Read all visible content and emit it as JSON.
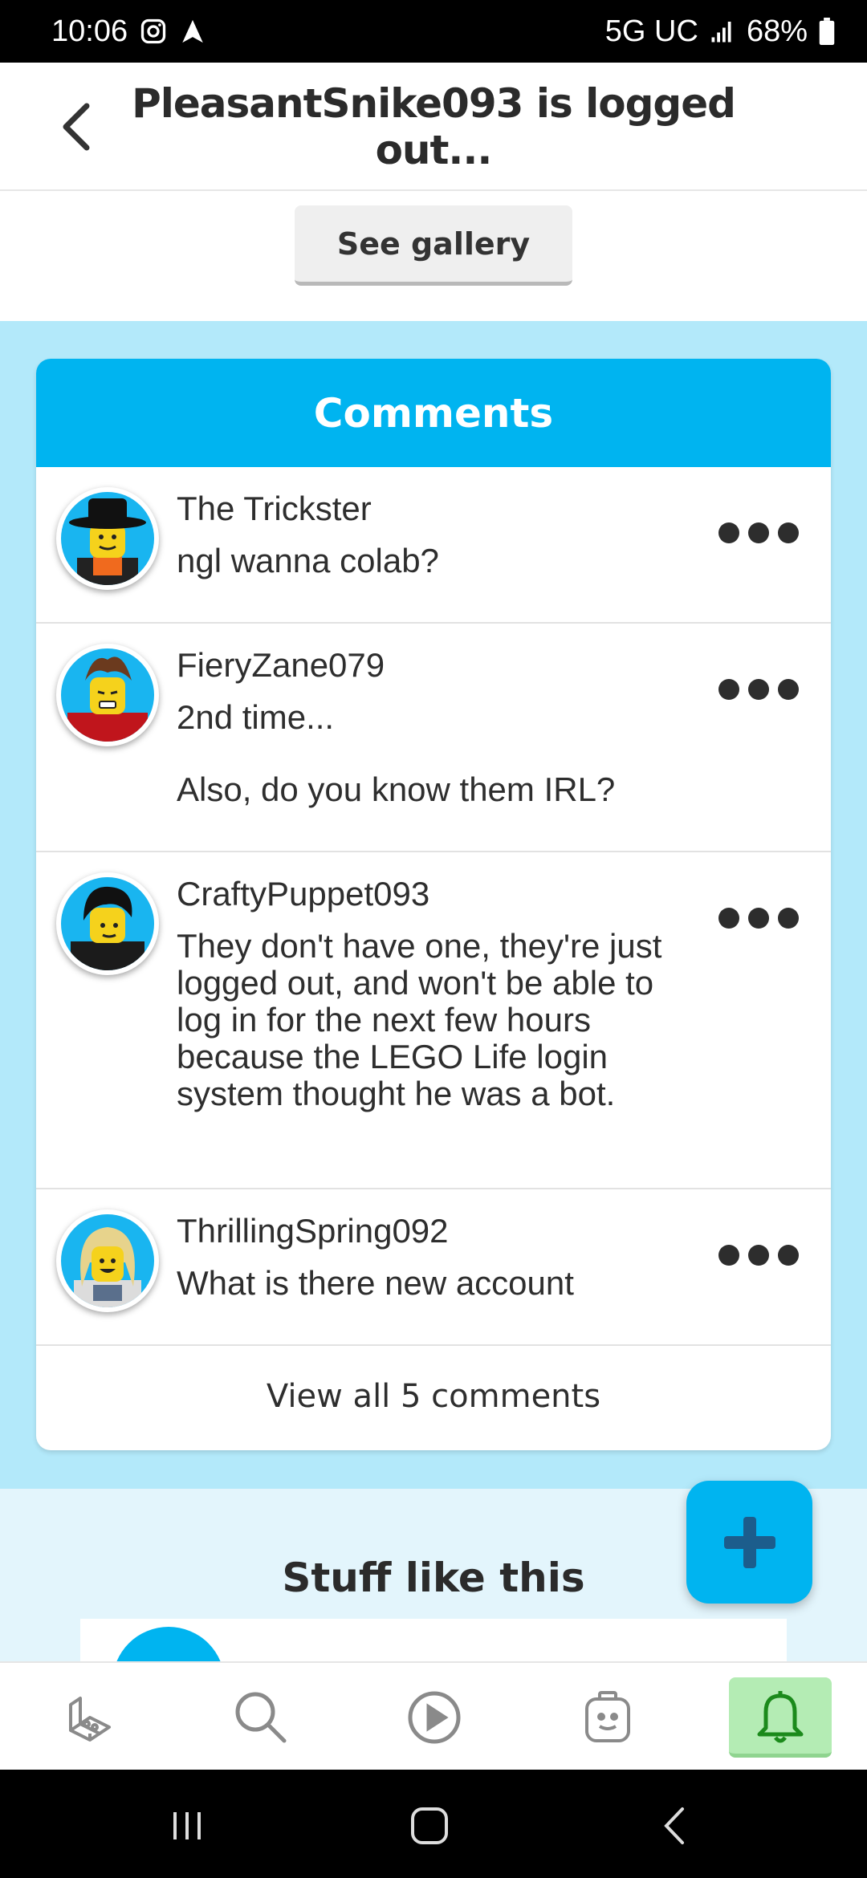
{
  "status_bar": {
    "time": "10:06",
    "network": "5G UC",
    "battery": "68%"
  },
  "header": {
    "title": "PleasantSnike093 is logged out..."
  },
  "gallery": {
    "see_gallery_label": "See gallery"
  },
  "comments": {
    "heading": "Comments",
    "items": [
      {
        "author": "The Trickster",
        "text": "ngl wanna colab?"
      },
      {
        "author": "FieryZane079",
        "text": "2nd time...",
        "text2": "Also, do you know them IRL?"
      },
      {
        "author": "CraftyPuppet093",
        "text": "They don't have one, they're just logged out, and won't be able to log in for the next few hours because the LEGO Life login system thought he was a bot."
      },
      {
        "author": "ThrillingSpring092",
        "text": "What is there new account"
      }
    ],
    "view_all_label": "View all 5 comments"
  },
  "related": {
    "title": "Stuff like this"
  },
  "bottom_nav": {
    "items": [
      "build-icon",
      "search-icon",
      "play-icon",
      "minifigure-icon",
      "bell-icon"
    ],
    "active": "bell-icon"
  },
  "colors": {
    "accent": "#00b4f0",
    "comments_background": "#b3e9fa",
    "active_nav": "#b4ecb4"
  }
}
